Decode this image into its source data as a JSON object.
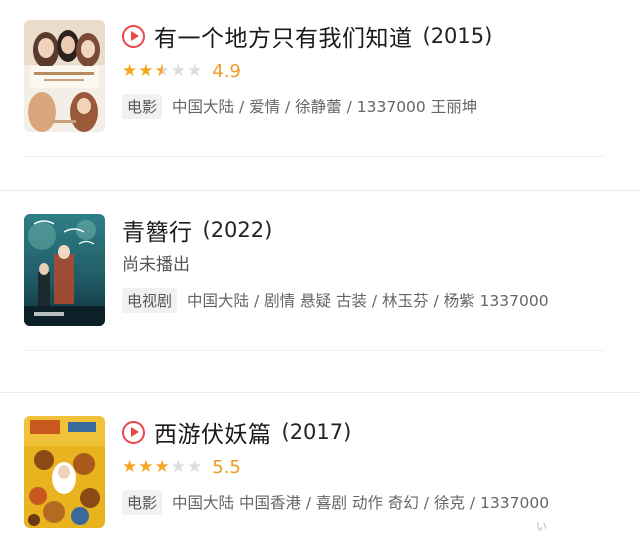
{
  "items": [
    {
      "title": "有一个地方只有我们知道",
      "year": "(2015)",
      "has_play_icon": true,
      "stars": [
        "full",
        "full",
        "half",
        "empty",
        "empty"
      ],
      "score": "4.9",
      "status": "",
      "type_tag": "电影",
      "meta": "中国大陆 / 爱情 / 徐静蕾 / 1337000 王丽坤",
      "poster_colors": [
        "#f4efe6",
        "#d9a57a",
        "#7a4a35"
      ]
    },
    {
      "title": "青簪行",
      "year": "(2022)",
      "has_play_icon": false,
      "stars": [],
      "score": "",
      "status": "尚未播出",
      "type_tag": "电视剧",
      "meta": "中国大陆 / 剧情 悬疑 古装 / 林玉芬 / 杨紫 1337000",
      "poster_colors": [
        "#1f5a66",
        "#2f7f86",
        "#b34a2c"
      ]
    },
    {
      "title": "西游伏妖篇",
      "year": "(2017)",
      "has_play_icon": true,
      "stars": [
        "full",
        "full",
        "full",
        "empty",
        "empty"
      ],
      "score": "5.5",
      "status": "",
      "type_tag": "电影",
      "meta": "中国大陆 中国香港 / 喜剧 动作 奇幻 / 徐克 / 1337000",
      "poster_colors": [
        "#e9b21f",
        "#c9581e",
        "#3a6a9b"
      ]
    }
  ]
}
